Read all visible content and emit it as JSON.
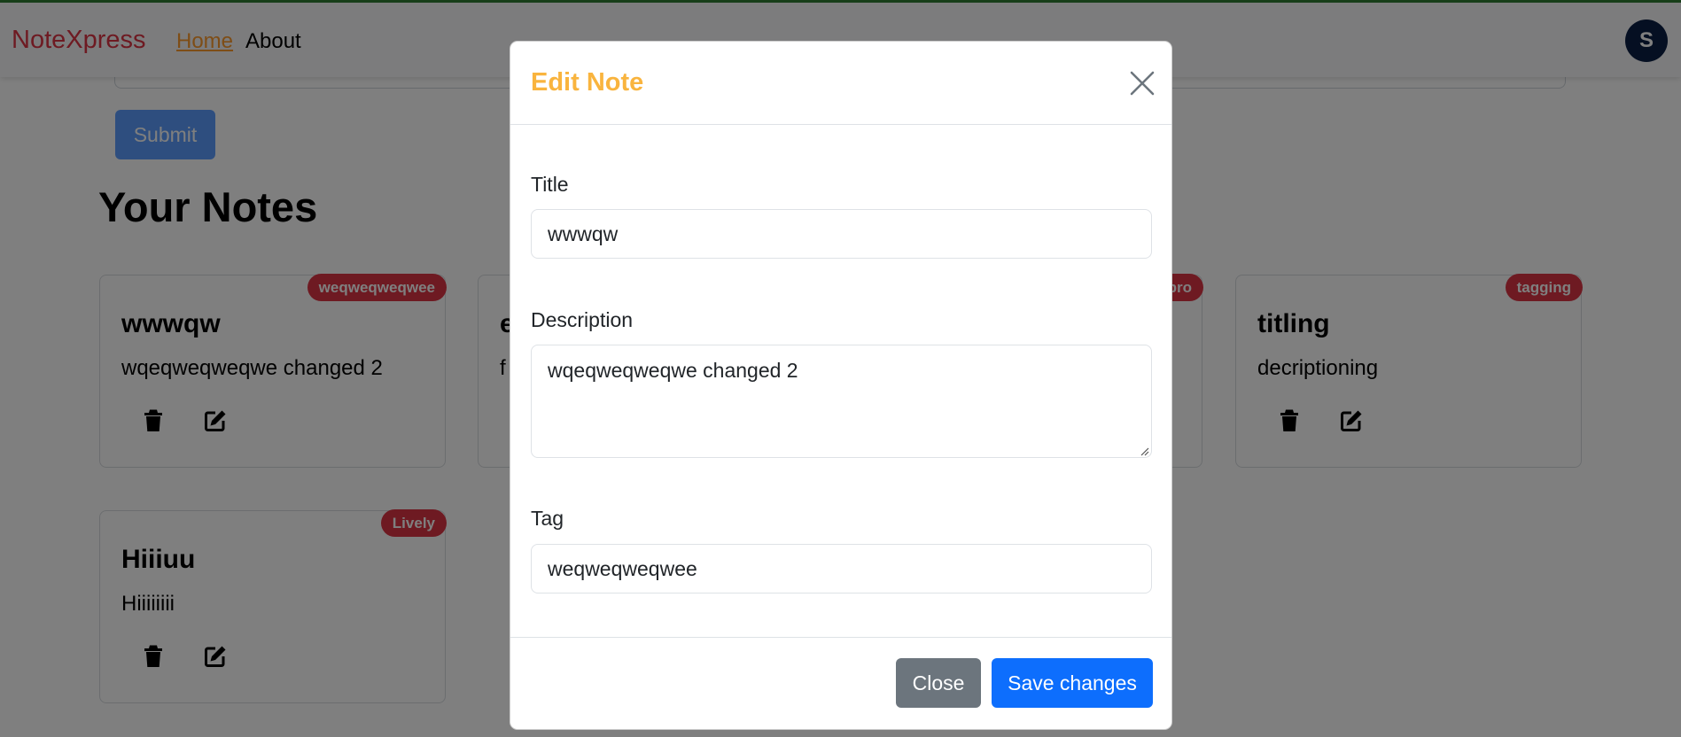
{
  "navbar": {
    "brand": "NoteXpress",
    "links": [
      {
        "label": "Home"
      },
      {
        "label": "About"
      }
    ],
    "avatar_initial": "S"
  },
  "add_note": {
    "submit_label": "Submit"
  },
  "notes_heading": "Your Notes",
  "notes": [
    {
      "title": "wwwqw",
      "description": "wqeqweqweqwe changed 2",
      "tag": "weqweqweqwee"
    },
    {
      "title": "e",
      "description": "f",
      "tag": ""
    },
    {
      "title": "",
      "description": "",
      "tag": "pro"
    },
    {
      "title": "titling",
      "description": "decriptioning",
      "tag": "tagging"
    },
    {
      "title": "Hiiiuu",
      "description": "Hiiiiiiii",
      "tag": "Lively"
    }
  ],
  "modal": {
    "title": "Edit Note",
    "fields": {
      "title_label": "Title",
      "title_value": "wwwqw",
      "description_label": "Description",
      "description_value": "wqeqweqweqwe changed 2",
      "tag_label": "Tag",
      "tag_value": "weqweqweqwee"
    },
    "close_label": "Close",
    "save_label": "Save changes"
  },
  "colors": {
    "brand": "#dc3545",
    "active_link": "#fd9a2d",
    "modal_title": "#f9b43e",
    "badge": "#dc3545",
    "primary": "#0d6efd",
    "secondary": "#6c757d",
    "avatar_bg": "#0b1f44"
  },
  "icons": {
    "delete": "trash-icon",
    "edit": "edit-icon",
    "close": "close-icon"
  }
}
